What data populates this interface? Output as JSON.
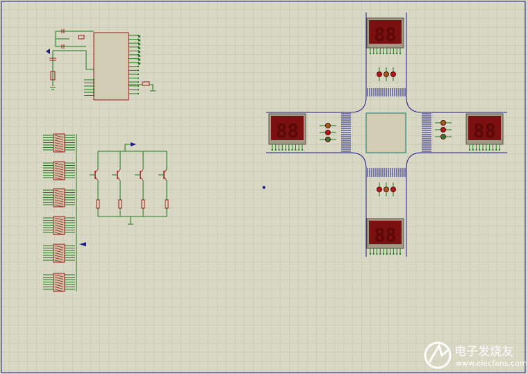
{
  "schematic": {
    "background_color": "#d9d8c4",
    "grid_color": "#c3c2ae",
    "wire_color": "#1a7a1a",
    "component_color": "#a01818",
    "road_color": "#1a1a8c",
    "display_color": "#7a1010",
    "led_red": "#b01818",
    "led_yellow": "#a06018",
    "led_green": "#2e7a2e",
    "digit_glyph": "88"
  },
  "watermark": {
    "brand": "电子发烧友",
    "site": "www.elecfans.com"
  }
}
